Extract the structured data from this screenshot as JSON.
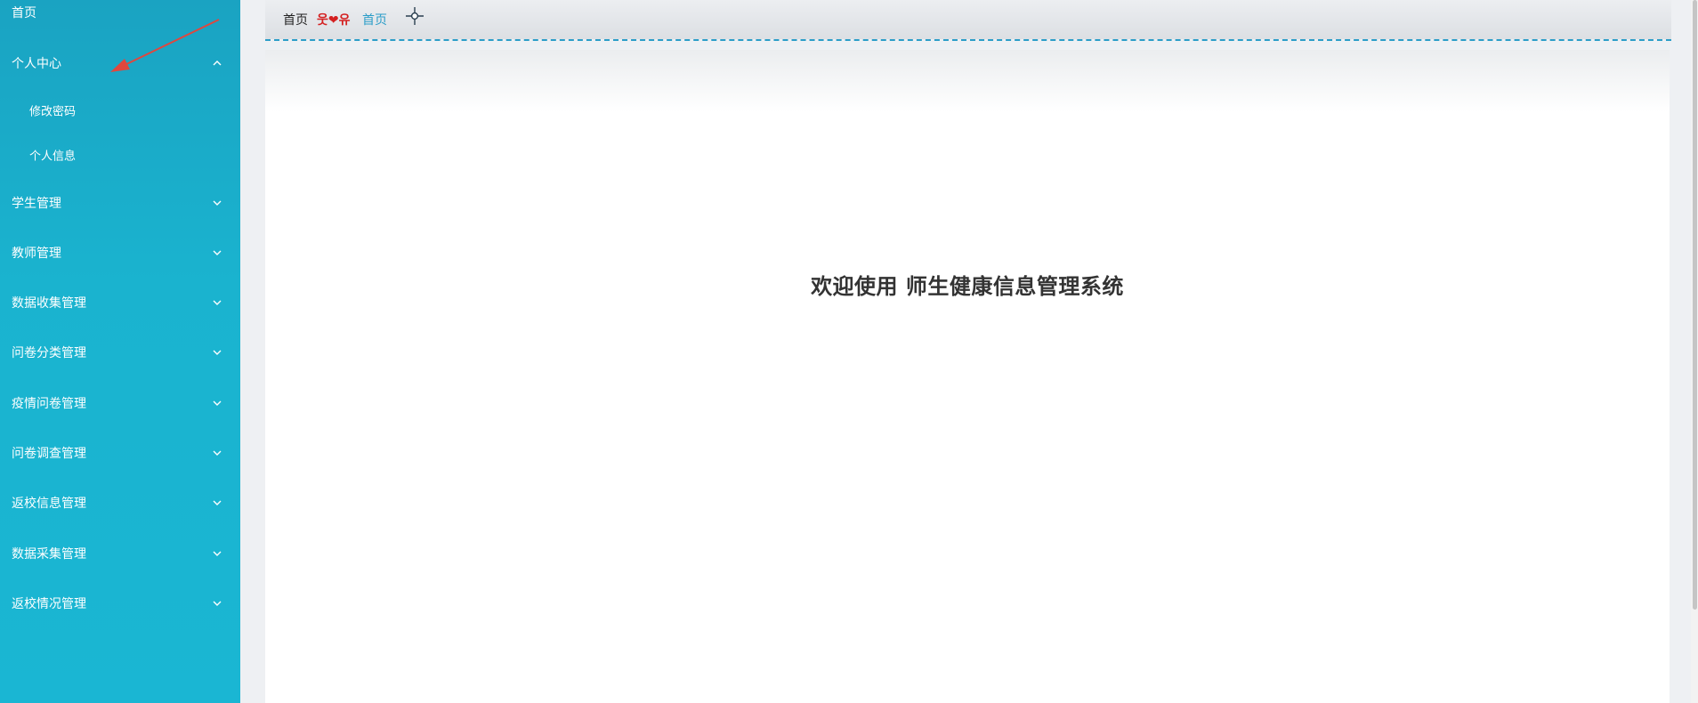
{
  "sidebar": {
    "home": "首页",
    "personal_center": "个人中心",
    "sub_items": [
      "修改密码",
      "个人信息"
    ],
    "groups": [
      "学生管理",
      "教师管理",
      "数据收集管理",
      "问卷分类管理",
      "疫情问卷管理",
      "问卷调查管理",
      "返校信息管理",
      "数据采集管理",
      "返校情况管理"
    ]
  },
  "breadcrumb": {
    "home": "首页",
    "decoration": "웃❤유",
    "current": "首页"
  },
  "main": {
    "welcome": "欢迎使用 师生健康信息管理系统"
  },
  "colors": {
    "sidebar_bg": "#1ab3cf",
    "accent": "#2b9dc8",
    "decoration": "#d42020"
  },
  "icons": {
    "expanded": "chevron-up-icon",
    "collapsed": "chevron-down-icon",
    "breadcrumb_action": "crosshair-icon"
  }
}
